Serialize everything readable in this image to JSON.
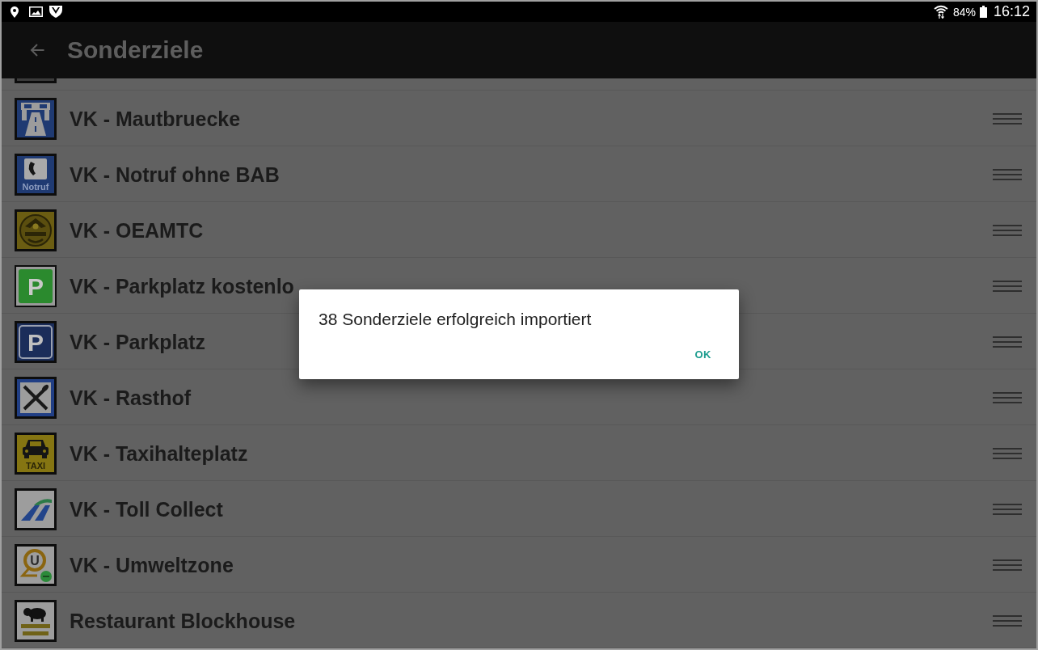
{
  "status_bar": {
    "battery": "84%",
    "time": "16:12"
  },
  "app_bar": {
    "title": "Sonderziele"
  },
  "list": {
    "items": [
      {
        "name": "VK - Mautbruecke"
      },
      {
        "name": "VK - Notruf ohne BAB",
        "sign_text": "Notruf"
      },
      {
        "name": "VK - OEAMTC"
      },
      {
        "name": "VK - Parkplatz kostenlo",
        "sign_text": "P"
      },
      {
        "name": "VK - Parkplatz",
        "sign_text": "P"
      },
      {
        "name": "VK - Rasthof"
      },
      {
        "name": "VK - Taxihalteplatz",
        "sign_text": "TAXI"
      },
      {
        "name": "VK - Toll Collect"
      },
      {
        "name": "VK - Umweltzone",
        "sign_text": "U"
      },
      {
        "name": "Restaurant Blockhouse"
      }
    ]
  },
  "dialog": {
    "message": "38 Sonderziele erfolgreich importiert",
    "buttons": [
      "OK"
    ]
  }
}
